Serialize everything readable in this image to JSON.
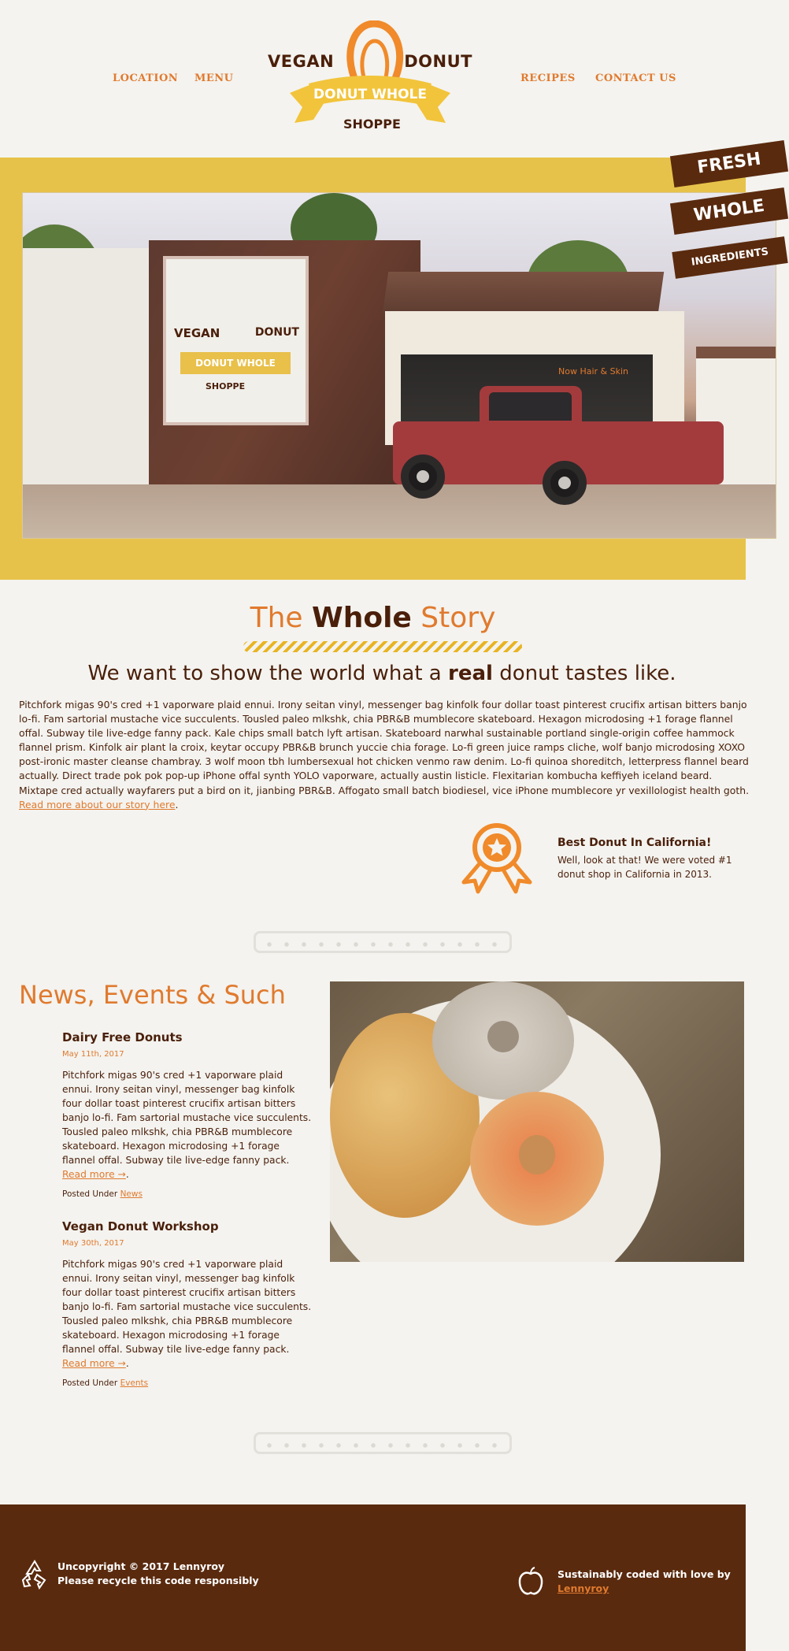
{
  "nav": {
    "location": "LOCATION",
    "menu": "MENU",
    "recipes": "RECIPES",
    "contact": "CONTACT US"
  },
  "logo": {
    "left": "VEGAN",
    "right": "DONUT",
    "banner": "DONUT WHOLE",
    "bottom": "SHOPPE"
  },
  "hero": {
    "ribbon": [
      "FRESH",
      "WHOLE",
      "INGREDIENTS"
    ],
    "store_script": "Now Hair & Skin"
  },
  "story": {
    "title_part1": "The",
    "title_part2": "Whole",
    "title_part3": "Story",
    "subtitle_part1": "We want to show the world what a",
    "subtitle_bold": "real",
    "subtitle_part2": "donut tastes like.",
    "body": "Pitchfork migas 90's cred +1 vaporware plaid ennui. Irony seitan vinyl, messenger bag kinfolk four dollar toast pinterest crucifix artisan bitters banjo lo-fi. Fam sartorial mustache vice succulents. Tousled paleo mlkshk, chia PBR&B mumblecore skateboard. Hexagon microdosing +1 forage flannel offal. Subway tile live-edge fanny pack. Kale chips small batch lyft artisan. Skateboard narwhal sustainable portland single-origin coffee hammock flannel prism. Kinfolk air plant la croix, keytar occupy PBR&B brunch yuccie chia forage. Lo-fi green juice ramps cliche, wolf banjo microdosing XOXO post-ironic master cleanse chambray. 3 wolf moon tbh lumbersexual hot chicken venmo raw denim. Lo-fi quinoa shoreditch, letterpress flannel beard actually. Direct trade pok pok pop-up iPhone offal synth YOLO vaporware, actually austin listicle. Flexitarian kombucha keffiyeh iceland beard. Mixtape cred actually wayfarers put a bird on it, jianbing PBR&B. Affogato small batch biodiesel, vice iPhone mumblecore yr vexillologist health goth.",
    "read_more": "Read more about our story here",
    "period": "."
  },
  "award": {
    "title": "Best Donut In California!",
    "text": "Well, look at that! We were voted #1 donut shop in California in 2013."
  },
  "news": {
    "heading": "News, Events & Such",
    "posts": [
      {
        "title": "Dairy Free Donuts",
        "date": "May 11th, 2017",
        "body": "Pitchfork migas 90's cred +1 vaporware plaid ennui. Irony seitan vinyl, messenger bag kinfolk four dollar toast pinterest crucifix artisan bitters banjo lo-fi. Fam sartorial mustache vice succulents. Tousled paleo mlkshk, chia PBR&B mumblecore skateboard. Hexagon microdosing +1 forage flannel offal. Subway tile live-edge fanny pack.",
        "read_more": "Read more →",
        "posted_under": "Posted Under",
        "category": "News"
      },
      {
        "title": "Vegan Donut Workshop",
        "date": "May 30th, 2017",
        "body": "Pitchfork migas 90's cred +1 vaporware plaid ennui. Irony seitan vinyl, messenger bag kinfolk four dollar toast pinterest crucifix artisan bitters banjo lo-fi. Fam sartorial mustache vice succulents. Tousled paleo mlkshk, chia PBR&B mumblecore skateboard. Hexagon microdosing +1 forage flannel offal. Subway tile live-edge fanny pack.",
        "read_more": "Read more →",
        "posted_under": "Posted Under",
        "category": "Events"
      }
    ]
  },
  "footer": {
    "left_line1": "Uncopyright © 2017 Lennyroy",
    "left_line2": "Please recycle this code responsibly",
    "right_line1": "Sustainably coded with love by",
    "right_link": "Lennyroy"
  },
  "colors": {
    "accent": "#e07a2e",
    "brown": "#4a1f0a",
    "yellow": "#e7c24a",
    "footer": "#5a2a0e"
  },
  "icons": [
    "recycle-icon",
    "apple-icon",
    "award-icon"
  ]
}
